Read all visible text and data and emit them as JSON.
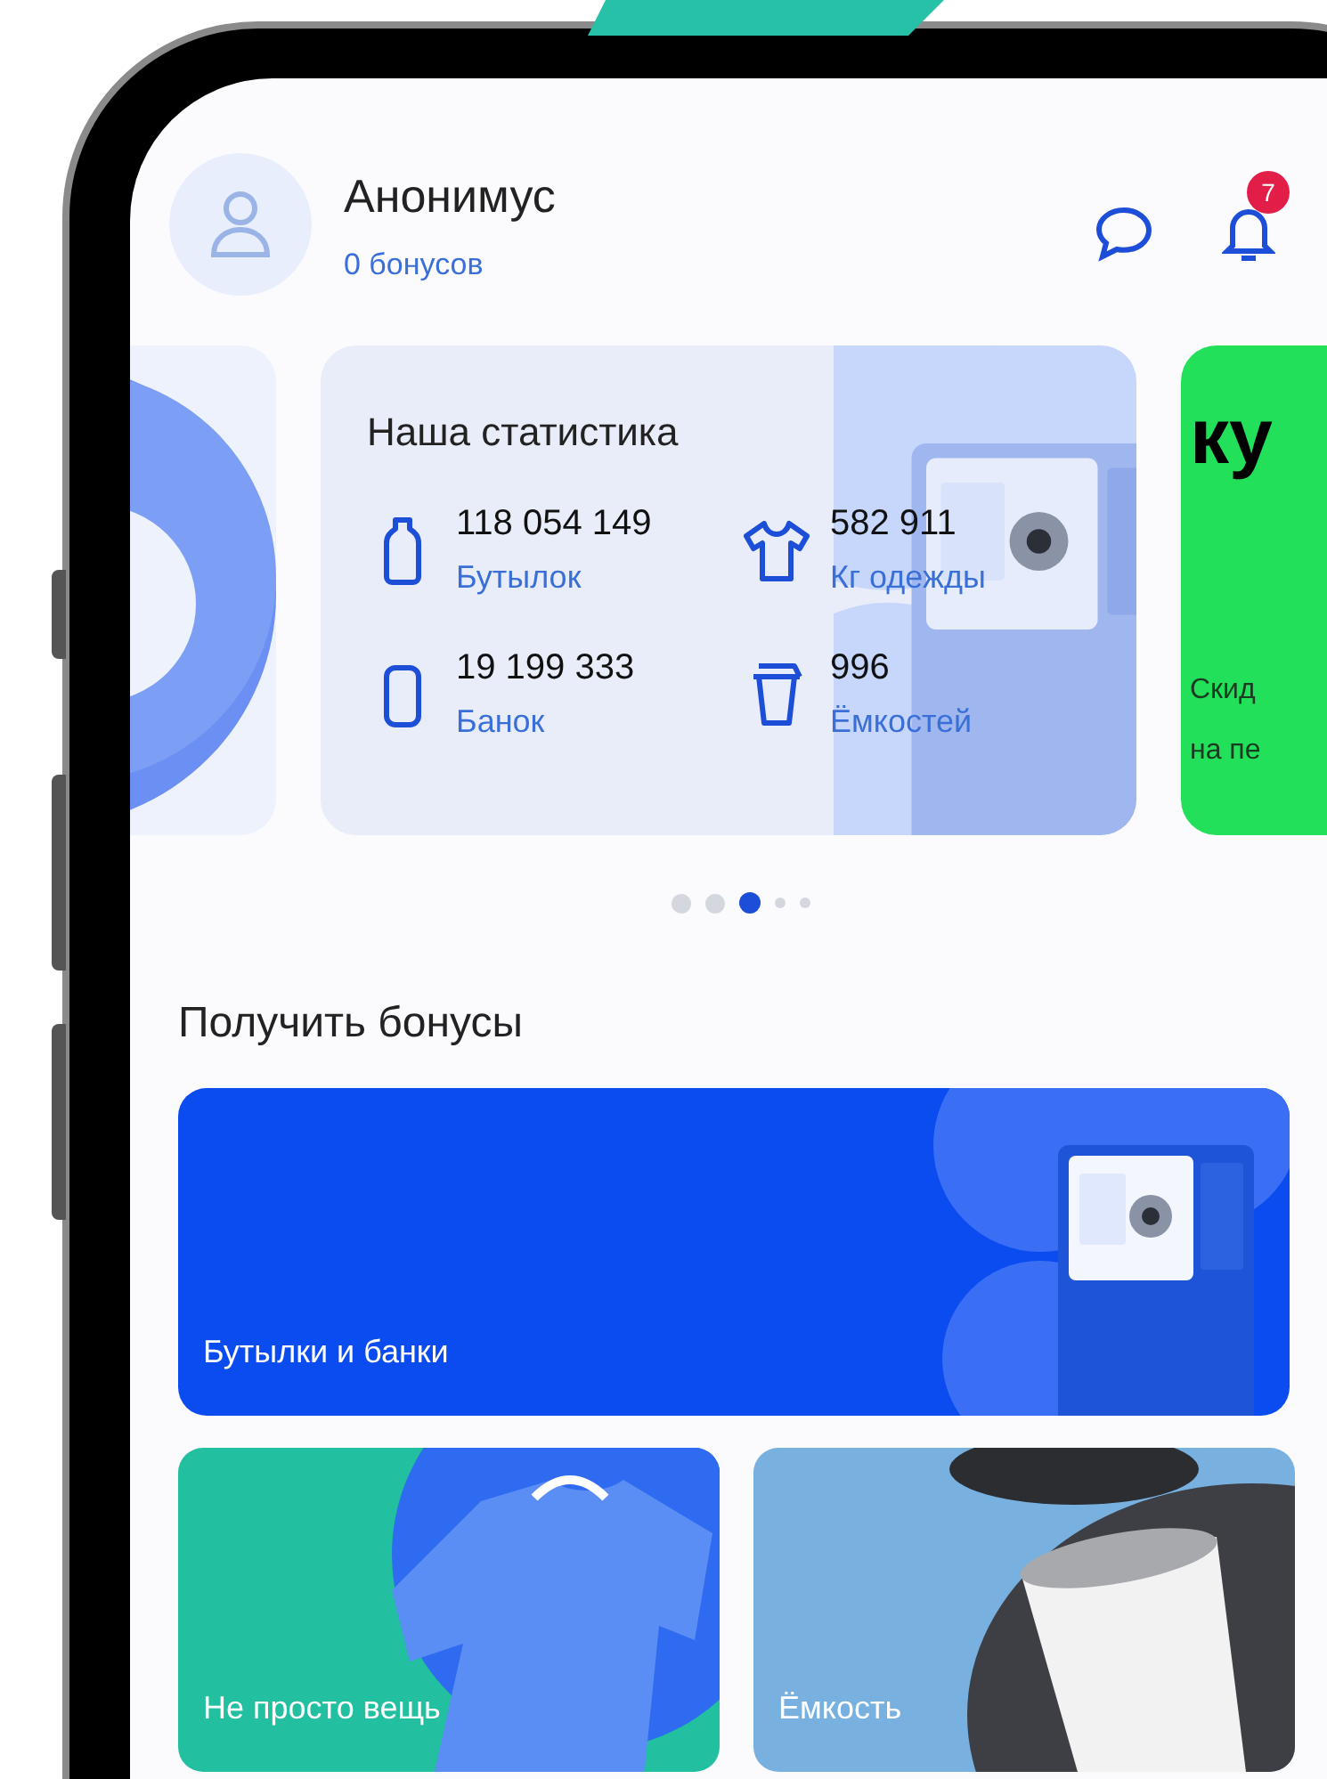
{
  "header": {
    "name": "Анонимус",
    "bonus": "0 бонусов",
    "notifications_badge": "7"
  },
  "carousel": {
    "cards": [
      {
        "kind": "picture"
      },
      {
        "kind": "stats",
        "title": "Наша статистика",
        "stats": [
          {
            "kind": "bottle",
            "value": "118 054 149",
            "label": "Бутылок"
          },
          {
            "kind": "shirt",
            "value": "582 911",
            "label": "Кг одежды"
          },
          {
            "kind": "can",
            "value": "19 199 333",
            "label": "Банок"
          },
          {
            "kind": "cup",
            "value": "996",
            "label": "Ёмкостей"
          }
        ]
      },
      {
        "kind": "promo",
        "logo": "ку",
        "lines": [
          "Скид",
          "на пе"
        ]
      }
    ],
    "dots": [
      {
        "selected": false
      },
      {
        "selected": false
      },
      {
        "selected": true
      },
      {
        "selected": false
      },
      {
        "selected": false
      }
    ]
  },
  "section_title": "Получить бонусы",
  "wide_card": {
    "title": "Бутылки и банки"
  },
  "cards": [
    {
      "title": "Не просто вещь",
      "color": "#22bfa0"
    },
    {
      "title": "Ёмкость",
      "color": "#78b0e0"
    }
  ]
}
